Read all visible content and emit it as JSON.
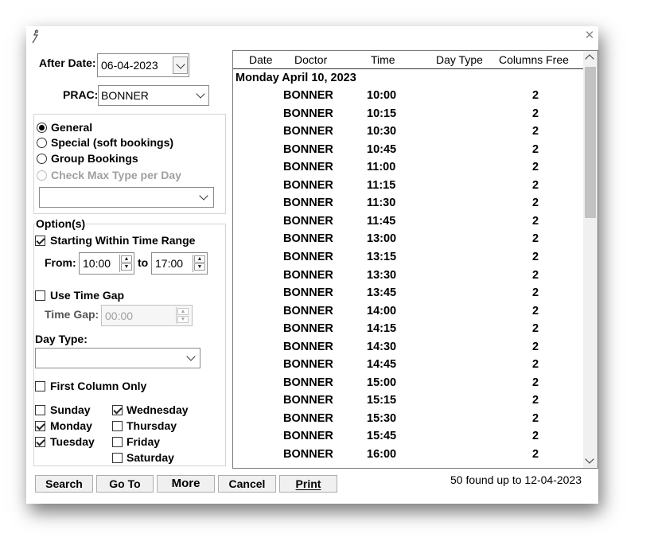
{
  "window": {
    "close_symbol": "✕"
  },
  "after_date": {
    "label": "After Date:",
    "value": "06-04-2023"
  },
  "prac": {
    "label": "PRAC:",
    "value": "BONNER"
  },
  "booking_type": {
    "options": [
      {
        "label": "General",
        "checked": true,
        "disabled": false
      },
      {
        "label": "Special (soft bookings)",
        "checked": false,
        "disabled": false
      },
      {
        "label": "Group Bookings",
        "checked": false,
        "disabled": false
      },
      {
        "label": "Check Max Type per Day",
        "checked": false,
        "disabled": true
      }
    ],
    "select_value": ""
  },
  "options_group": {
    "title": "Option(s)",
    "starting_within": {
      "label": "Starting Within Time Range",
      "checked": true
    },
    "from_label": "From:",
    "from_value": "10:00",
    "to_label": "to",
    "to_value": "17:00",
    "use_time_gap": {
      "label": "Use Time Gap",
      "checked": false
    },
    "time_gap_label": "Time Gap:",
    "time_gap_value": "00:00",
    "day_type_label": "Day Type:",
    "day_type_value": "",
    "first_column_only": {
      "label": "First Column Only",
      "checked": false
    },
    "days": [
      {
        "label": "Sunday",
        "checked": false
      },
      {
        "label": "Monday",
        "checked": true
      },
      {
        "label": "Tuesday",
        "checked": true
      },
      {
        "label": "Wednesday",
        "checked": true
      },
      {
        "label": "Thursday",
        "checked": false
      },
      {
        "label": "Friday",
        "checked": false
      },
      {
        "label": "Saturday",
        "checked": false
      }
    ]
  },
  "results": {
    "columns": [
      "Date",
      "Doctor",
      "Time",
      "Day Type",
      "Columns Free"
    ],
    "group_header": "Monday April 10, 2023",
    "rows": [
      {
        "doctor": "BONNER",
        "time": "10:00",
        "free": "2"
      },
      {
        "doctor": "BONNER",
        "time": "10:15",
        "free": "2"
      },
      {
        "doctor": "BONNER",
        "time": "10:30",
        "free": "2"
      },
      {
        "doctor": "BONNER",
        "time": "10:45",
        "free": "2"
      },
      {
        "doctor": "BONNER",
        "time": "11:00",
        "free": "2"
      },
      {
        "doctor": "BONNER",
        "time": "11:15",
        "free": "2"
      },
      {
        "doctor": "BONNER",
        "time": "11:30",
        "free": "2"
      },
      {
        "doctor": "BONNER",
        "time": "11:45",
        "free": "2"
      },
      {
        "doctor": "BONNER",
        "time": "13:00",
        "free": "2"
      },
      {
        "doctor": "BONNER",
        "time": "13:15",
        "free": "2"
      },
      {
        "doctor": "BONNER",
        "time": "13:30",
        "free": "2"
      },
      {
        "doctor": "BONNER",
        "time": "13:45",
        "free": "2"
      },
      {
        "doctor": "BONNER",
        "time": "14:00",
        "free": "2"
      },
      {
        "doctor": "BONNER",
        "time": "14:15",
        "free": "2"
      },
      {
        "doctor": "BONNER",
        "time": "14:30",
        "free": "2"
      },
      {
        "doctor": "BONNER",
        "time": "14:45",
        "free": "2"
      },
      {
        "doctor": "BONNER",
        "time": "15:00",
        "free": "2"
      },
      {
        "doctor": "BONNER",
        "time": "15:15",
        "free": "2"
      },
      {
        "doctor": "BONNER",
        "time": "15:30",
        "free": "2"
      },
      {
        "doctor": "BONNER",
        "time": "15:45",
        "free": "2"
      },
      {
        "doctor": "BONNER",
        "time": "16:00",
        "free": "2"
      }
    ]
  },
  "buttons": {
    "search": "Search",
    "goto": "Go To",
    "more": "More",
    "cancel": "Cancel",
    "print": "Print"
  },
  "status": "50 found up to 12-04-2023"
}
